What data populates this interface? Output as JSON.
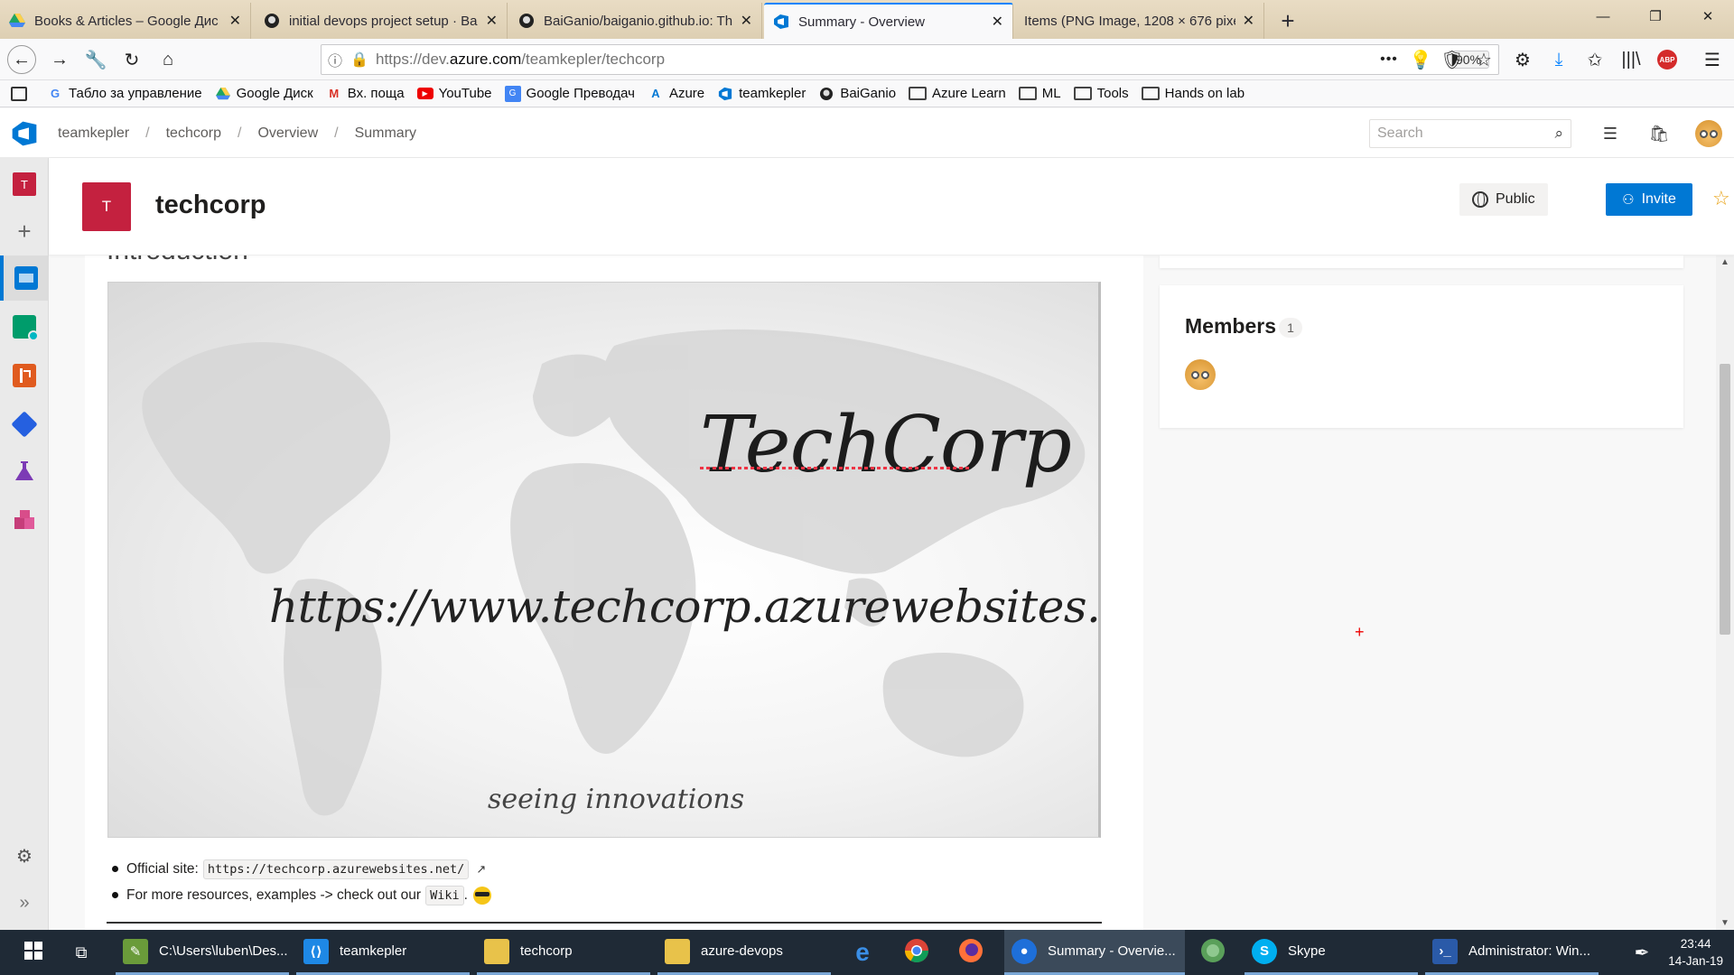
{
  "browser": {
    "tabs": [
      {
        "title": "Books & Articles – Google Дис",
        "icon": "google-drive-icon",
        "active": false
      },
      {
        "title": "initial devops project setup · Ba",
        "icon": "github-icon",
        "active": false
      },
      {
        "title": "BaiGanio/baiganio.github.io: Th",
        "icon": "github-icon",
        "active": false
      },
      {
        "title": "Summary - Overview",
        "icon": "azure-devops-icon",
        "active": true
      },
      {
        "title": "Items (PNG Image, 1208 × 676 pixe",
        "icon": "image-icon",
        "active": false
      }
    ],
    "url_prefix": "https://dev.",
    "url_domain": "azure.com",
    "url_path": "/teamkepler/techcorp",
    "zoom": "90%",
    "bookmarks": [
      {
        "label": "Табло за управление",
        "icon": "google-icon"
      },
      {
        "label": "Google Диск",
        "icon": "google-drive-icon"
      },
      {
        "label": "Вх. поща",
        "icon": "gmail-icon"
      },
      {
        "label": "YouTube",
        "icon": "youtube-icon"
      },
      {
        "label": "Google Преводач",
        "icon": "google-translate-icon"
      },
      {
        "label": "Azure",
        "icon": "azure-icon"
      },
      {
        "label": "teamkepler",
        "icon": "azure-devops-icon"
      },
      {
        "label": "BaiGanio",
        "icon": "github-icon"
      },
      {
        "label": "Azure Learn",
        "icon": "folder-icon"
      },
      {
        "label": "ML",
        "icon": "folder-icon"
      },
      {
        "label": "Tools",
        "icon": "folder-icon"
      },
      {
        "label": "Hands on lab",
        "icon": "folder-icon"
      }
    ]
  },
  "devops": {
    "breadcrumb": [
      "teamkepler",
      "techcorp",
      "Overview",
      "Summary"
    ],
    "search_placeholder": "Search",
    "project": {
      "initial": "T",
      "name": "techcorp",
      "public_label": "Public",
      "invite_label": "Invite"
    },
    "nav_badge": "T"
  },
  "readme": {
    "heading": "Introduction",
    "image_brand": "TechCorp",
    "image_url": "https://www.techcorp.azurewebsites.net",
    "image_tagline": "seeing innovations",
    "bullet1_text": "Official site:",
    "bullet1_code": "https://techcorp.azurewebsites.net/",
    "bullet2_text": "For more resources, examples -> check out our",
    "bullet2_code": "Wiki",
    "bullet2_suffix": "."
  },
  "members": {
    "title": "Members",
    "count": "1"
  },
  "taskbar": {
    "items": [
      {
        "label": "C:\\Users\\luben\\Des...",
        "icon": "notepad-icon",
        "color": "#6a9b3a"
      },
      {
        "label": "teamkepler",
        "icon": "visual-studio-code-icon",
        "color": "#1e88e5"
      },
      {
        "label": "techcorp",
        "icon": "folder-icon",
        "color": "#e8c24a"
      },
      {
        "label": "azure-devops",
        "icon": "folder-icon",
        "color": "#e8c24a"
      },
      {
        "label": "Summary - Overvie...",
        "icon": "firefox-icon",
        "color": "#1e6fd9"
      },
      {
        "label": "Skype",
        "icon": "skype-icon",
        "color": "#00aff0"
      },
      {
        "label": "Administrator: Win...",
        "icon": "powershell-icon",
        "color": "#2a5aa8"
      }
    ],
    "time": "23:44",
    "date": "14-Jan-19"
  }
}
